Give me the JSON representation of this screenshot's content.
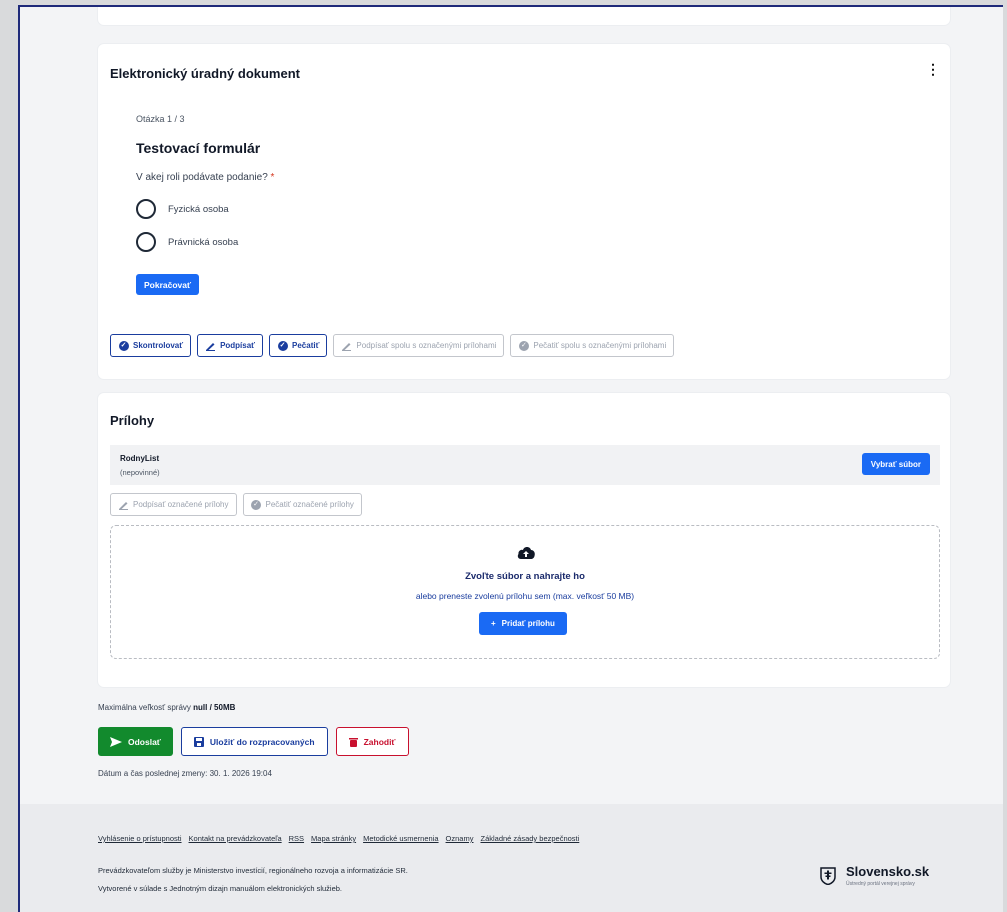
{
  "document": {
    "title": "Elektronický úradný dokument",
    "menu_icon": "kebab-menu-icon",
    "step": "Otázka 1 / 3",
    "form_title": "Testovací formulár",
    "question": "V akej roli podávate podanie?",
    "required_mark": "*",
    "options": [
      "Fyzická osoba",
      "Právnická osoba"
    ],
    "continue_label": "Pokračovať",
    "sign_buttons": [
      {
        "label": "Skontrolovať",
        "icon": "check-shield-icon",
        "enabled": true
      },
      {
        "label": "Podpísať",
        "icon": "pen-icon",
        "enabled": true
      },
      {
        "label": "Pečatiť",
        "icon": "seal-icon",
        "enabled": true
      },
      {
        "label": "Podpísať spolu s označenými prílohami",
        "icon": "pen-icon",
        "enabled": false
      },
      {
        "label": "Pečatiť spolu s označenými prílohami",
        "icon": "seal-icon",
        "enabled": false
      }
    ]
  },
  "attachments": {
    "title": "Prílohy",
    "item": {
      "name": "RodnyList",
      "optional": "(nepovinné)",
      "choose_label": "Vybrať súbor"
    },
    "actions": [
      {
        "label": "Podpísať označené prílohy",
        "icon": "pen-icon"
      },
      {
        "label": "Pečatiť označené prílohy",
        "icon": "seal-icon"
      }
    ],
    "dropzone": {
      "icon": "cloud-upload-icon",
      "title": "Zvoľte súbor a nahrajte ho",
      "subtitle": "alebo preneste zvolenú prílohu sem (max. veľkosť 50 MB)",
      "add_label": "Pridať prílohu"
    }
  },
  "message": {
    "max_size_label": "Maximálna veľkosť správy",
    "max_size_value": "null / 50MB",
    "send_label": "Odoslať",
    "save_label": "Uložiť do rozpracovaných",
    "discard_label": "Zahodiť",
    "last_change": "Dátum a čas poslednej zmeny: 30. 1. 2026 19:04"
  },
  "footer": {
    "links": [
      "Vyhlásenie o prístupnosti",
      "Kontakt na prevádzkovateľa",
      "RSS",
      "Mapa stránky",
      "Metodické usmernenia",
      "Oznamy",
      "Základné zásady bezpečnosti"
    ],
    "operator": "Prevádzkovateľom služby je Ministerstvo investícií, regionálneho rozvoja a informatizácie SR.",
    "design": "Vytvorené v súlade s Jednotným dizajn manuálom elektronických služieb.",
    "brand_name": "Slovensko.sk",
    "brand_sub": "Ústredný portál verejnej správy"
  },
  "colors": {
    "primary": "#1a6af4",
    "navy": "#1a3d9e",
    "send": "#128a2d",
    "danger": "#c8102e"
  }
}
